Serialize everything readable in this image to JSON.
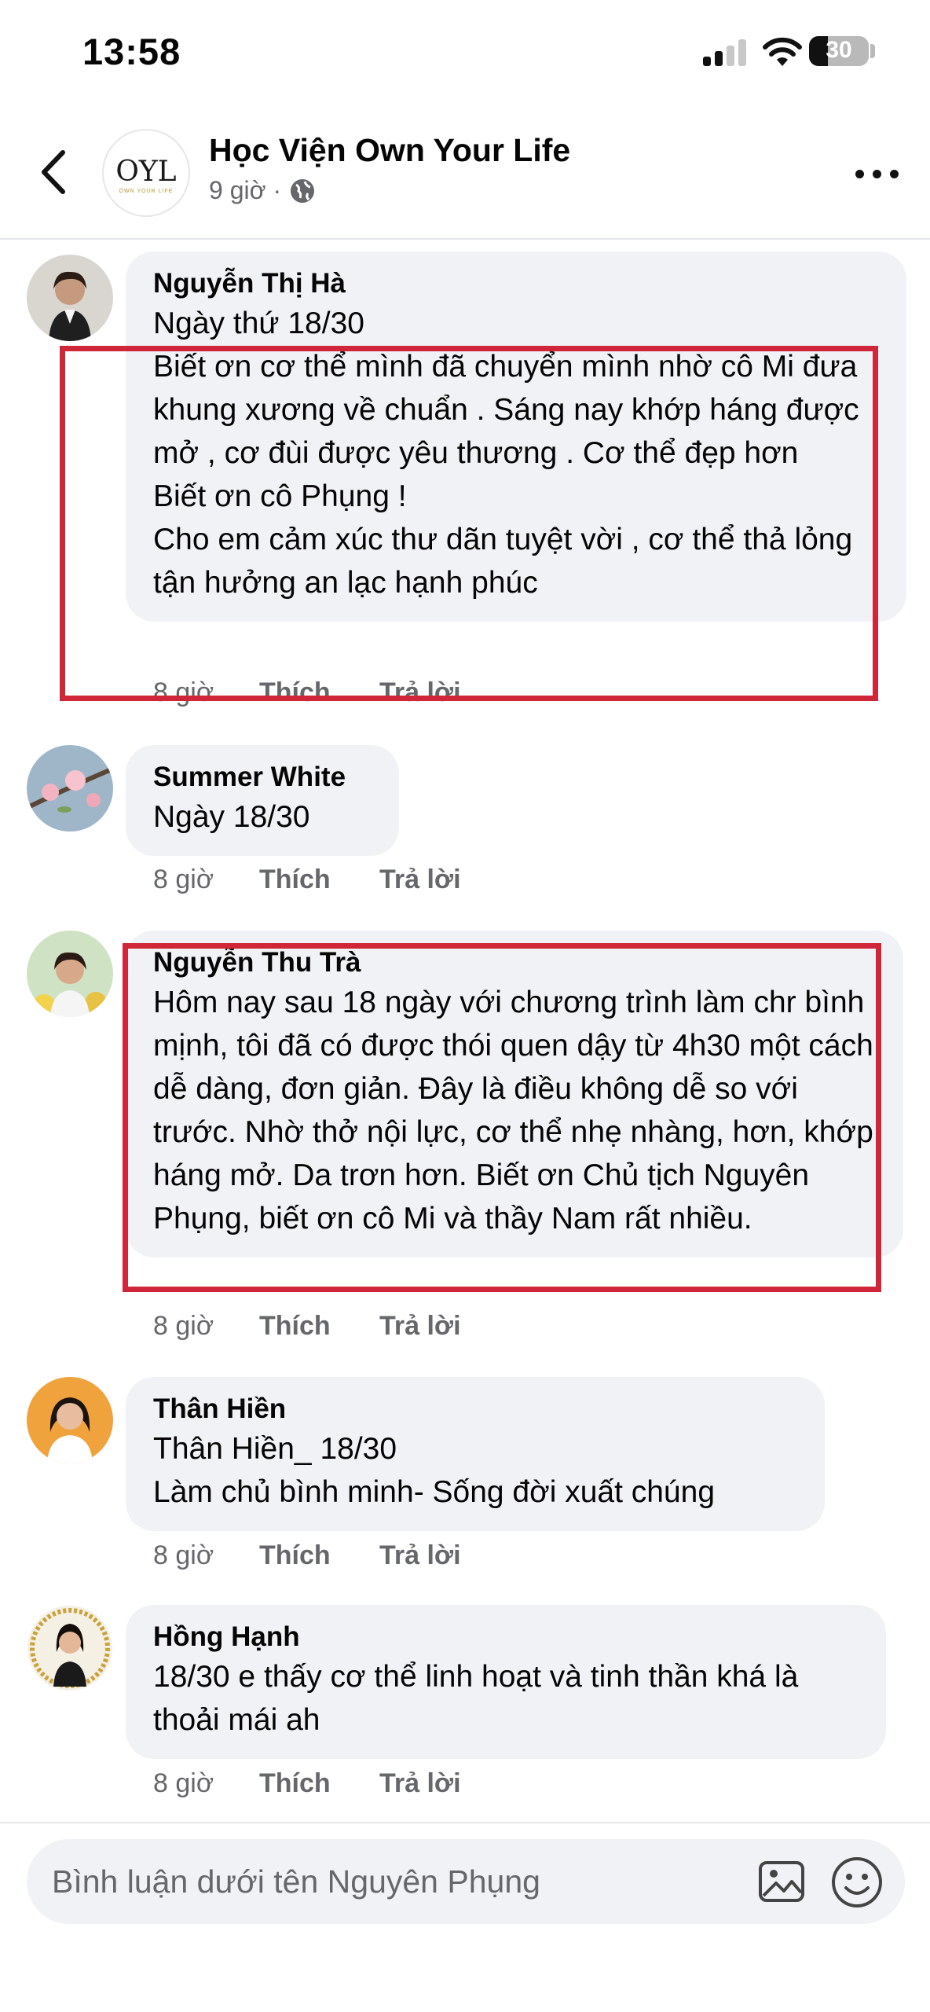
{
  "status": {
    "time": "13:58",
    "battery": "30"
  },
  "header": {
    "page_name": "Học Viện Own Your Life",
    "post_time": "9 giờ ·",
    "logo_text": "OYL",
    "logo_sub": "OWN YOUR LIFE"
  },
  "comments": [
    {
      "author": "Nguyễn Thị Hà",
      "text": "Ngày thứ 18/30\nBiết ơn cơ thể mình đã chuyển mình  nhờ cô Mi đưa khung xương về chuẩn . Sáng nay khớp háng được mở , cơ đùi được yêu thương . Cơ thể đẹp hơn\nBiết ơn cô Phụng !\nCho em cảm xúc thư dãn tuyệt vời , cơ thể thả lỏng tận hưởng an lạc hạnh phúc",
      "time": "8 giờ",
      "like": "Thích",
      "reply": "Trả lời"
    },
    {
      "author": "Summer White",
      "text": "Ngày 18/30",
      "time": "8 giờ",
      "like": "Thích",
      "reply": "Trả lời"
    },
    {
      "author": "Nguyễn Thu Trà",
      "text": "Hôm nay sau 18 ngày với chương trình làm chr bình mịnh, tôi đã có được thói quen dậy từ 4h30 một cách dễ dàng, đơn giản. Đây là điều không dễ so với trước. Nhờ thở nội lực, cơ thể nhẹ nhàng, hơn, khớp háng mở. Da trơn hơn. Biết ơn Chủ tịch Nguyên Phụng, biết ơn cô Mi và thầy Nam rất nhiều.",
      "time": "8 giờ",
      "like": "Thích",
      "reply": "Trả lời"
    },
    {
      "author": "Thân Hiền",
      "text": "Thân Hiền_ 18/30\nLàm chủ bình minh- Sống đời xuất chúng",
      "time": "8 giờ",
      "like": "Thích",
      "reply": "Trả lời"
    },
    {
      "author": "Hồng Hạnh",
      "text": "18/30 e thấy cơ thể linh hoạt và tinh thần khá là thoải mái ah",
      "time": "8 giờ",
      "like": "Thích",
      "reply": "Trả lời"
    }
  ],
  "composer": {
    "placeholder": "Bình luận dưới tên Nguyên Phụng"
  },
  "colors": {
    "highlight": "#d0263a",
    "bubble": "#f0f2f5",
    "secondary_text": "#65676b"
  }
}
